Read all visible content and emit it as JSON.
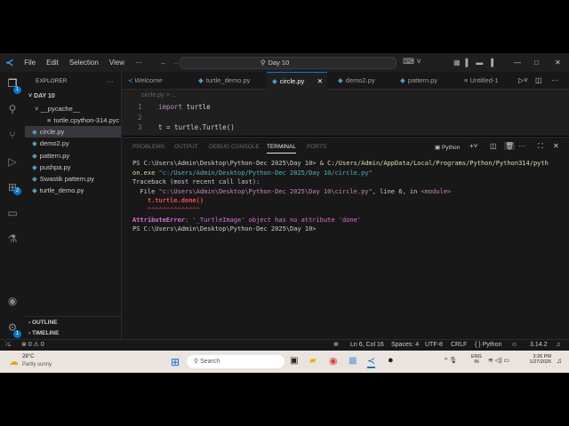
{
  "titlebar": {
    "menus": [
      "File",
      "Edit",
      "Selection",
      "View",
      "···"
    ],
    "search": "Day 10"
  },
  "activity": {
    "explorer_badge": "1",
    "settings_badge": "1"
  },
  "sidebar": {
    "title": "EXPLORER",
    "more": "···",
    "folder": "DAY 10",
    "items": [
      {
        "label": "__pycache__",
        "type": "folder"
      },
      {
        "label": "turtle.cpython-314.pyc",
        "type": "pyc"
      },
      {
        "label": "circle.py",
        "type": "py"
      },
      {
        "label": "demo2.py",
        "type": "py"
      },
      {
        "label": "pattern.py",
        "type": "py"
      },
      {
        "label": "pushpa.py",
        "type": "py"
      },
      {
        "label": "Swastik pattern.py",
        "type": "py"
      },
      {
        "label": "turtle_demo.py",
        "type": "py"
      }
    ],
    "outline": "OUTLINE",
    "timeline": "TIMELINE"
  },
  "tabs": [
    "Welcome",
    "turtle_demo.py",
    "circle.py",
    "demo2.py",
    "pattern.py",
    "Untitled-1"
  ],
  "editor": {
    "breadcrumb": "circle.py > ...",
    "lines": [
      {
        "n": "1",
        "kw": "import",
        "rest": " turtle"
      },
      {
        "n": "2",
        "kw": "",
        "rest": ""
      },
      {
        "n": "3",
        "kw": "",
        "rest": "t = turtle.Turtle()"
      }
    ]
  },
  "panel": {
    "tabs": [
      "PROBLEMS",
      "OUTPUT",
      "DEBUG CONSOLE",
      "TERMINAL",
      "PORTS"
    ],
    "shell": "Python",
    "terminal": {
      "l1a": "PS C:\\Users\\Admin\\Desktop\\Python-Dec 2025\\Day 10> & ",
      "l1b": "C:/Users/Admin/AppData/Local/Programs/Python/Python314/pyth",
      "l2a": "on.exe ",
      "l2b": "\"c:/Users/Admin/Desktop/Python-Dec 2025/Day 10/circle.py\"",
      "l3": "Traceback (most recent call last):",
      "l4a": "  File ",
      "l4b": "\"c:\\Users\\Admin\\Desktop\\Python-Dec 2025\\Day 10\\circle.py\"",
      "l4c": ", line 6, in ",
      "l4d": "<module>",
      "l5": "    t.turtle.done()",
      "l6": "    ^^^^^^^^^^^^^^",
      "l7a": "AttributeError",
      "l7b": ": '_TurtleImage' object has no attribute 'done'",
      "l8": "PS C:\\Users\\Admin\\Desktop\\Python-Dec 2025\\Day 10>"
    }
  },
  "status": {
    "errors": "0",
    "warnings": "0",
    "position": "Ln 6, Col 16",
    "spaces": "Spaces: 4",
    "encoding": "UTF-8",
    "eol": "CRLF",
    "language": "{ } Python",
    "version": "3.14.2"
  },
  "taskbar": {
    "temp": "28°C",
    "weather": "Partly sunny",
    "search": "Search",
    "lang1": "ENG",
    "lang2": "IN",
    "time": "3:26 PM",
    "date": "1/27/2026"
  }
}
